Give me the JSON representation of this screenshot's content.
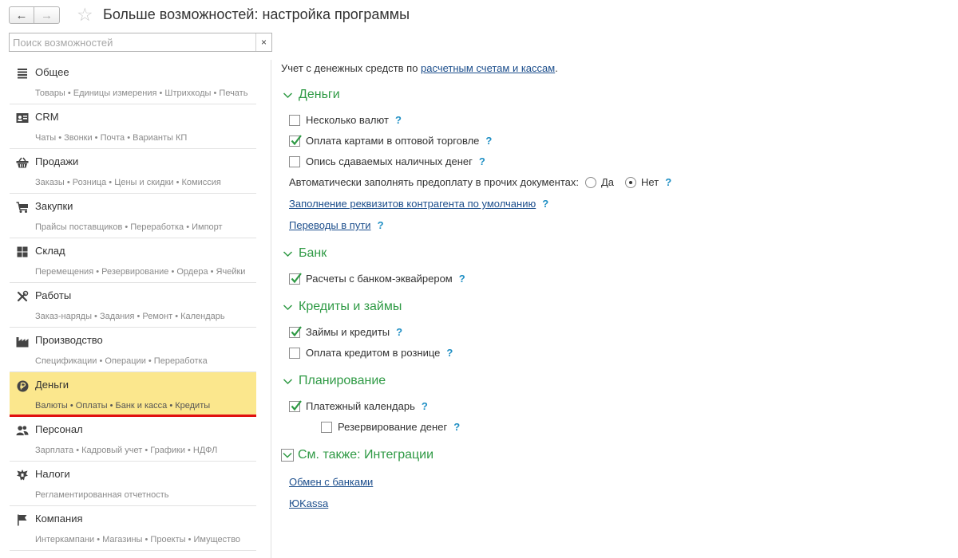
{
  "header": {
    "back": "←",
    "forward": "→",
    "title": "Больше возможностей: настройка программы"
  },
  "search": {
    "placeholder": "Поиск возможностей",
    "clear": "×"
  },
  "sidebar": {
    "sections": [
      {
        "title": "Общее",
        "subtitle": "Товары • Единицы измерения • Штрихкоды • Печать",
        "icon": "list-icon"
      },
      {
        "title": "CRM",
        "subtitle": "Чаты • Звонки • Почта • Варианты КП",
        "icon": "contact-card-icon"
      },
      {
        "title": "Продажи",
        "subtitle": "Заказы • Розница • Цены и скидки • Комиссия",
        "icon": "basket-icon"
      },
      {
        "title": "Закупки",
        "subtitle": "Прайсы поставщиков • Переработка • Импорт",
        "icon": "cart-icon"
      },
      {
        "title": "Склад",
        "subtitle": "Перемещения • Резервирование • Ордера • Ячейки",
        "icon": "warehouse-icon"
      },
      {
        "title": "Работы",
        "subtitle": "Заказ-наряды • Задания • Ремонт • Календарь",
        "icon": "tools-icon"
      },
      {
        "title": "Производство",
        "subtitle": "Спецификации • Операции • Переработка",
        "icon": "factory-icon"
      },
      {
        "title": "Деньги",
        "subtitle": "Валюты • Оплаты • Банк и касса • Кредиты",
        "icon": "ruble-icon",
        "active": true
      },
      {
        "title": "Персонал",
        "subtitle": "Зарплата • Кадровый учет • Графики • НДФЛ",
        "icon": "people-icon"
      },
      {
        "title": "Налоги",
        "subtitle": "Регламентированная отчетность",
        "icon": "eagle-icon"
      },
      {
        "title": "Компания",
        "subtitle": "Интеркампани • Магазины • Проекты • Имущество",
        "icon": "flag-icon"
      }
    ]
  },
  "content": {
    "intro_text": "Учет с денежных средств по ",
    "intro_link": "расчетным счетам и кассам",
    "intro_end": ".",
    "help": "?",
    "money": {
      "title": "Деньги",
      "multi_currency": "Несколько валют",
      "card_payments": "Оплата картами в оптовой торговле",
      "cash_inventory": "Опись сдаваемых наличных денег",
      "auto_prepay": "Автоматически заполнять предоплату в прочих документах:",
      "yes": "Да",
      "no": "Нет",
      "counterparty_link": "Заполнение реквизитов контрагента по умолчанию",
      "transfers_link": "Переводы в пути"
    },
    "bank": {
      "title": "Банк",
      "acquirer": "Расчеты с банком-эквайрером"
    },
    "credits": {
      "title": "Кредиты и займы",
      "loans": "Займы и кредиты",
      "retail_credit": "Оплата кредитом в рознице"
    },
    "planning": {
      "title": "Планирование",
      "calendar": "Платежный календарь",
      "reserve": "Резервирование денег"
    },
    "see_also": {
      "title": "См. также: Интеграции",
      "bank_exchange": "Обмен с банками",
      "ukassa": "ЮKassa"
    }
  },
  "checkbox_states": {
    "multi_currency": false,
    "card_payments": true,
    "cash_inventory": false,
    "acquirer": true,
    "loans": true,
    "retail_credit": false,
    "calendar": true,
    "reserve": false,
    "auto_prepay": "Нет"
  },
  "colors": {
    "accent_green": "#2f9a45",
    "active_section": "#fbe78d",
    "active_underline": "#e01010",
    "link": "#1c4e8c",
    "help": "#1f8fc4"
  }
}
